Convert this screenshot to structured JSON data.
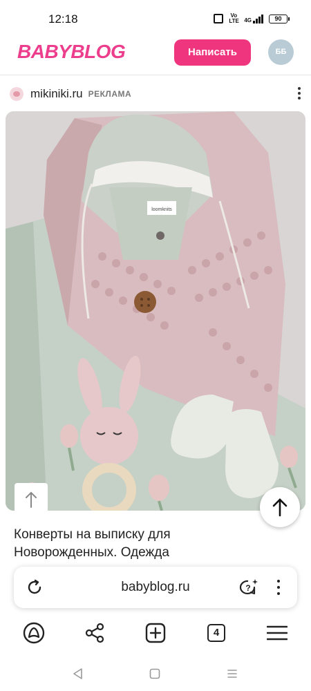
{
  "status_bar": {
    "time": "12:18",
    "volte": "Vo LTE",
    "network": "4G",
    "battery": "90"
  },
  "header": {
    "logo": "BABYBLOG",
    "write_button": "Написать",
    "avatar_initials": "ББ",
    "brand_color": "#ec3e8c"
  },
  "ad": {
    "domain": "mikiniki.ru",
    "label": "РЕКЛАМА",
    "title": "Конверты на выписку для Новорожденных. Одежда",
    "image_label": "loomknits"
  },
  "browser": {
    "url": "babyblog.ru",
    "tab_count": "4",
    "icons": [
      "reload-icon",
      "assistant-icon",
      "more-icon",
      "alice-icon",
      "share-icon",
      "new-tab-icon",
      "tabs-icon",
      "menu-icon"
    ]
  },
  "android_nav": {
    "icons": [
      "back-icon",
      "home-icon",
      "recents-icon"
    ]
  }
}
